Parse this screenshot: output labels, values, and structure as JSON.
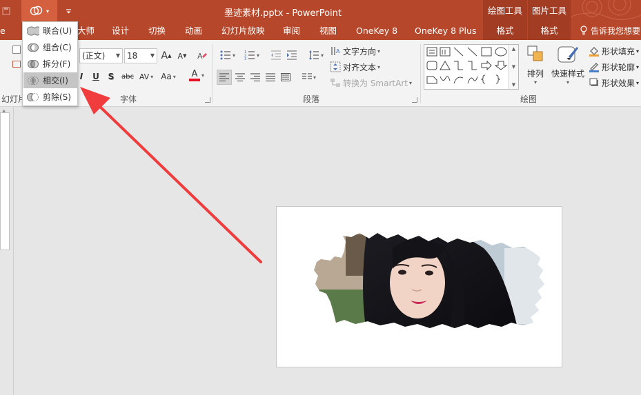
{
  "window": {
    "title": "墨迹素材.pptx - PowerPoint",
    "context_groups": [
      "绘图工具",
      "图片工具"
    ]
  },
  "quick_access": {
    "shape_button_icon": "merge-shapes-icon",
    "customize_icon": "customize-qat-icon"
  },
  "tabs": {
    "partial_left": "e",
    "partial_master": "大师",
    "items": [
      "设计",
      "切换",
      "动画",
      "幻灯片放映",
      "审阅",
      "视图",
      "OneKey 8",
      "OneKey 8 Plus"
    ],
    "format_drawing": "格式",
    "format_picture": "格式",
    "tell_me": "告诉我您想要"
  },
  "ribbon": {
    "font": {
      "font_name": "(正文)",
      "font_size": "18",
      "grow_label": "A",
      "shrink_label": "A",
      "italic": "I",
      "underline": "U",
      "shadow": "S",
      "strike": "abc",
      "spacing": "AV",
      "case": "Aa",
      "color_label": "A",
      "group_label": "字体"
    },
    "paragraph": {
      "text_direction": "文字方向",
      "align_text": "对齐文本",
      "smartart": "转换为 SmartArt",
      "group_label": "段落"
    },
    "drawing": {
      "arrange": "排列",
      "quick_styles": "快速样式",
      "fill": "形状填充",
      "outline": "形状轮廓",
      "effects": "形状效果",
      "group_label": "绘图"
    },
    "slides_group_partial": "幻灯片"
  },
  "merge_menu": {
    "items": [
      {
        "label": "联合(U)",
        "icon": "union-icon"
      },
      {
        "label": "组合(C)",
        "icon": "combine-icon"
      },
      {
        "label": "拆分(F)",
        "icon": "fragment-icon"
      },
      {
        "label": "相交(I)",
        "icon": "intersect-icon"
      },
      {
        "label": "剪除(S)",
        "icon": "subtract-icon"
      }
    ],
    "highlighted_index": 3
  },
  "colors": {
    "accent": "#b7472a",
    "context_tab": "#a23c23",
    "annotation_arrow": "#f03c3c",
    "font_color_bar": "#e81123"
  }
}
